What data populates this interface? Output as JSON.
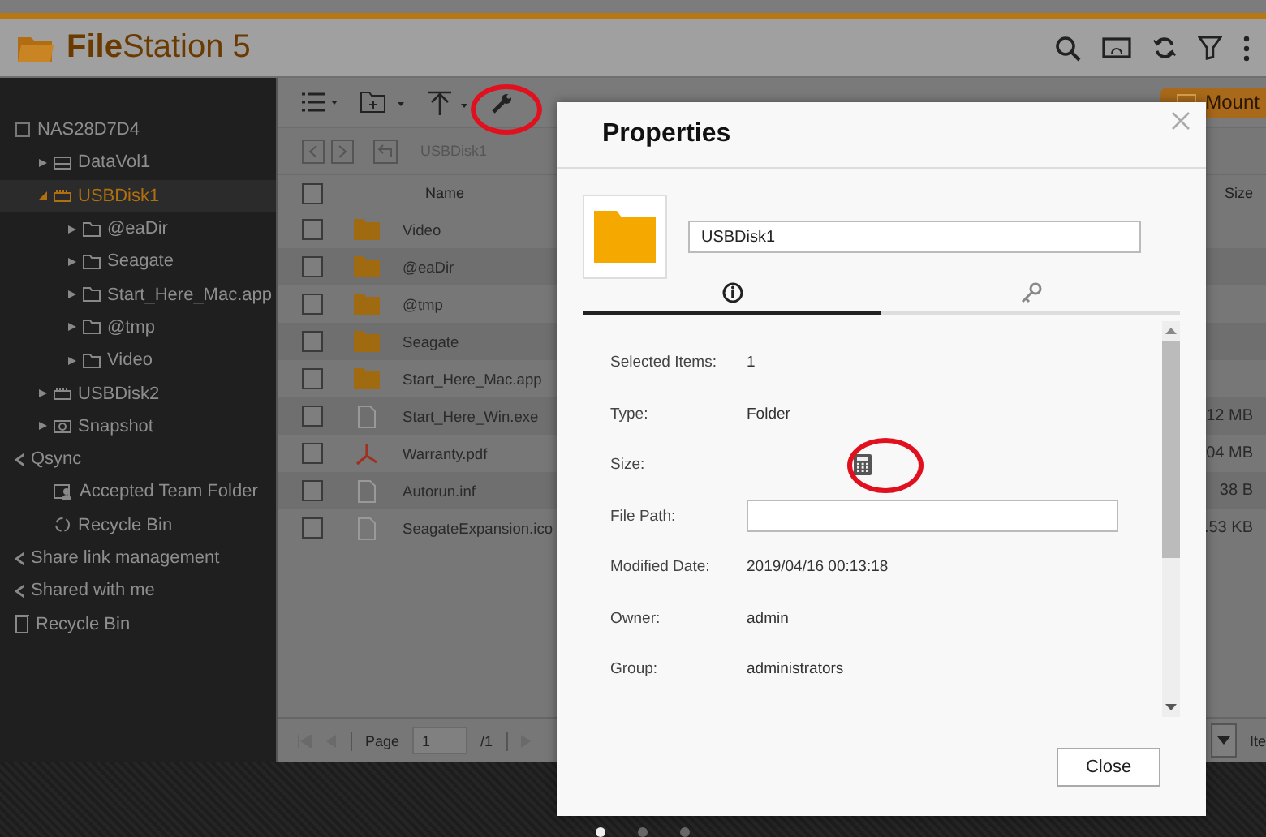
{
  "app": {
    "logo_text": "**File**Station 5"
  },
  "sidebar": {
    "tree": [
      {
        "label": "NAS28D7D4",
        "kind": "server",
        "selected": false,
        "children": [
          {
            "label": "DataVol1",
            "kind": "drive",
            "selected": false,
            "expanded": false
          },
          {
            "label": "USBDisk1",
            "kind": "usb",
            "selected": true,
            "expanded": true,
            "children": [
              {
                "label": "@eaDir",
                "kind": "folder",
                "selected": false,
                "expanded": false
              },
              {
                "label": "Seagate",
                "kind": "folder",
                "selected": false,
                "expanded": false
              },
              {
                "label": "Start_Here_Mac.app",
                "kind": "folder",
                "selected": false,
                "expanded": false
              },
              {
                "label": "@tmp",
                "kind": "folder",
                "selected": false,
                "expanded": false
              },
              {
                "label": "Video",
                "kind": "folder",
                "selected": false,
                "expanded": false
              }
            ]
          },
          {
            "label": "USBDisk2",
            "kind": "usb",
            "selected": false,
            "expanded": false
          },
          {
            "label": "Snapshot",
            "kind": "snapshot",
            "selected": false,
            "expanded": false
          }
        ]
      },
      {
        "label": "Qsync",
        "kind": "qsync",
        "selected": false,
        "children": [
          {
            "label": "Accepted Team Folder",
            "kind": "team",
            "selected": false
          },
          {
            "label": "Recycle Bin",
            "kind": "recycle",
            "selected": false
          }
        ]
      },
      {
        "label": "Share link management",
        "kind": "share",
        "selected": false
      },
      {
        "label": "Shared with me",
        "kind": "shared",
        "selected": false
      },
      {
        "label": "Recycle Bin",
        "kind": "trash",
        "selected": false
      }
    ]
  },
  "toolbar": {
    "remote_mount_label": "Mount"
  },
  "breadcrumb": {
    "path": "USBDisk1"
  },
  "table": {
    "columns": [
      "Name",
      "Size"
    ],
    "select_all_checked": false,
    "rows": [
      {
        "name": "Video",
        "kind": "folder",
        "checked": false
      },
      {
        "name": "@eaDir",
        "kind": "folder",
        "checked": false
      },
      {
        "name": "@tmp",
        "kind": "folder",
        "checked": false
      },
      {
        "name": "Seagate",
        "kind": "folder",
        "checked": false
      },
      {
        "name": "Start_Here_Mac.app",
        "kind": "folder",
        "checked": false
      },
      {
        "name": "Start_Here_Win.exe",
        "kind": "file",
        "checked": false,
        "size": "12 MB"
      },
      {
        "name": "Warranty.pdf",
        "kind": "pdf",
        "checked": false,
        "size": "04 MB"
      },
      {
        "name": "Autorun.inf",
        "kind": "file",
        "checked": false,
        "size": "38 B"
      },
      {
        "name": "SeagateExpansion.ico",
        "kind": "file",
        "checked": false,
        "size": ".53 KB"
      }
    ]
  },
  "pagination": {
    "label": "Page",
    "page": "1",
    "total": "/1",
    "per_page_label": "Ite"
  },
  "dialog": {
    "title": "Properties",
    "name_value": "USBDisk1",
    "tabs": [
      {
        "kind": "info",
        "selected": true
      },
      {
        "kind": "key",
        "selected": false
      }
    ],
    "properties": [
      {
        "label": "Selected Items:",
        "kind": "text",
        "value": "1"
      },
      {
        "label": "Type:",
        "kind": "text",
        "value": "Folder"
      },
      {
        "label": "Size:",
        "kind": "calculate"
      },
      {
        "label": "File Path:",
        "kind": "field"
      },
      {
        "label": "Modified Date:",
        "kind": "text",
        "value": "2019/04/16 00:13:18"
      },
      {
        "label": "Owner:",
        "kind": "text",
        "value": "admin"
      },
      {
        "label": "Group:",
        "kind": "text",
        "value": "administrators"
      }
    ],
    "close_label": "Close"
  },
  "carousel_dots": [
    {
      "selected": true
    },
    {
      "selected": false
    },
    {
      "selected": false
    }
  ]
}
